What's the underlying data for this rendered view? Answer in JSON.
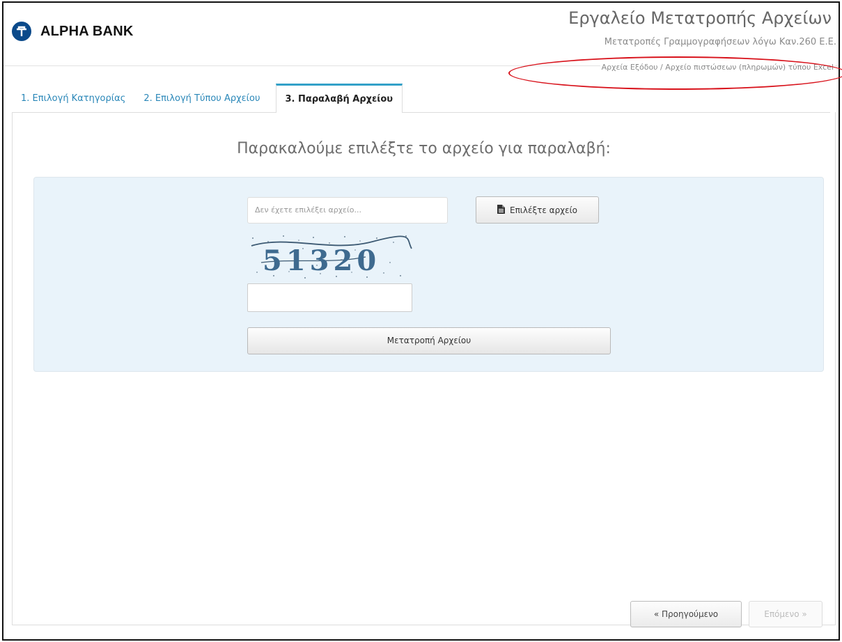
{
  "header": {
    "brand": "ALPHA BANK",
    "title": "Εργαλείο Μετατροπής Αρχείων",
    "subtitle": "Μετατροπές Γραμμογραφήσεων λόγω Καν.260 Ε.Ε.",
    "breadcrumb": "Αρχεία Εξόδου / Αρχείο πιστώσεων (πληρωμών) τύπου Excel"
  },
  "tabs": [
    {
      "label": "1. Επιλογή Κατηγορίας",
      "active": false
    },
    {
      "label": "2. Επιλογή Τύπου Αρχείου",
      "active": false
    },
    {
      "label": "3. Παραλαβή Αρχείου",
      "active": true
    }
  ],
  "main": {
    "prompt": "Παρακαλούμε επιλέξτε το αρχείο για παραλαβή:",
    "file_placeholder": "Δεν έχετε επιλέξει αρχείο...",
    "choose_label": "Επιλέξτε αρχείο",
    "captcha_text": "51320",
    "captcha_value": "",
    "convert_label": "Μετατροπή Αρχείου"
  },
  "footer": {
    "prev_label": "« Προηγούμενο",
    "next_label": "Επόμενο »"
  },
  "colors": {
    "brand_blue": "#0b4a8a",
    "tab_link": "#2a87b8",
    "tab_accent": "#33a1c8",
    "panel_bg": "#e9f3fa",
    "annotation_red": "#d8121b"
  },
  "icons": {
    "logo": "alpha-bank-logo-icon",
    "choose": "file-icon"
  }
}
